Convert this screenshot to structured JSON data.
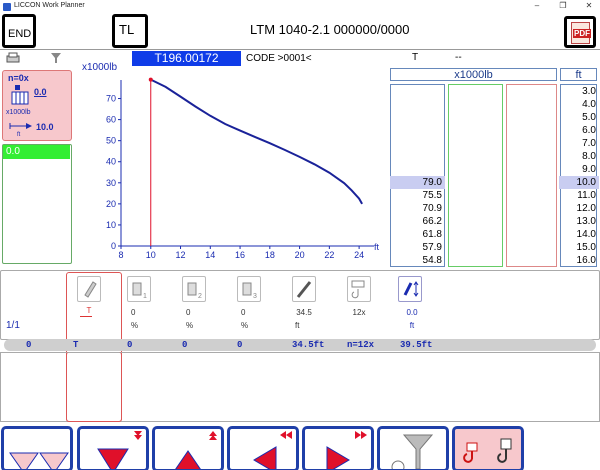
{
  "window": {
    "app_title": "LICCON Work Planner"
  },
  "header": {
    "end_label": "END",
    "tl_label": "TL",
    "title": "LTM 1040-2.1  000000/0000",
    "pdf_label": "PDF"
  },
  "info": {
    "test_id": "T196.00172",
    "code": "CODE >0001<",
    "mode": "T",
    "mode_value": "--"
  },
  "config": {
    "counterweight": "n=0x",
    "load_value": "0.0",
    "load_unit": "x1000lb",
    "radius_value": "10.0",
    "radius_unit": "ft",
    "green_value": "0.0"
  },
  "table": {
    "load_header": "x1000lb",
    "ft_header": "ft",
    "ft_values": [
      "3.0",
      "4.0",
      "5.0",
      "6.0",
      "7.0",
      "8.0",
      "9.0",
      "10.0",
      "11.0",
      "12.0",
      "13.0",
      "14.0",
      "15.0",
      "16.0"
    ],
    "load_values": [
      "79.0",
      "75.5",
      "70.9",
      "66.2",
      "61.8",
      "57.9",
      "54.8"
    ]
  },
  "chart_data": {
    "type": "line",
    "ylabel": "x1000lb",
    "xlabel": "ft",
    "xlim": [
      8,
      25
    ],
    "ylim": [
      0,
      75
    ],
    "x_ticks": [
      8,
      10,
      12,
      14,
      16,
      18,
      20,
      22,
      24
    ],
    "y_ticks": [
      0,
      10,
      20,
      30,
      40,
      50,
      60,
      70
    ],
    "series": [
      {
        "x": [
          10,
          11,
          12,
          13,
          14,
          15,
          16,
          17,
          18,
          19,
          20,
          21,
          22,
          23,
          23.5,
          24,
          24.2
        ],
        "y": [
          79,
          75.5,
          70.9,
          66.2,
          61.8,
          57.9,
          54.8,
          51.8,
          48.8,
          45.6,
          42.3,
          38.8,
          34.8,
          29.8,
          26.4,
          22.5,
          20
        ]
      }
    ],
    "color": "#1a2299"
  },
  "controls": {
    "page": "1/1",
    "items": [
      {
        "id": "mode",
        "value": "T",
        "unit": ""
      },
      {
        "id": "ctl1",
        "value": "0",
        "unit": "%"
      },
      {
        "id": "ctl2",
        "value": "0",
        "unit": "%"
      },
      {
        "id": "ctl3",
        "value": "0",
        "unit": "%"
      },
      {
        "id": "boom",
        "value": "34.5",
        "unit": "ft"
      },
      {
        "id": "reeving",
        "value": "12x",
        "unit": ""
      },
      {
        "id": "hook",
        "value": "0.0",
        "unit": "ft"
      }
    ]
  },
  "summary": {
    "c1": "0",
    "c2": "T",
    "c3": "0",
    "c4": "0",
    "c5": "0",
    "c6": "34.5ft",
    "c7": "n=12x",
    "c8": "39.5ft"
  }
}
